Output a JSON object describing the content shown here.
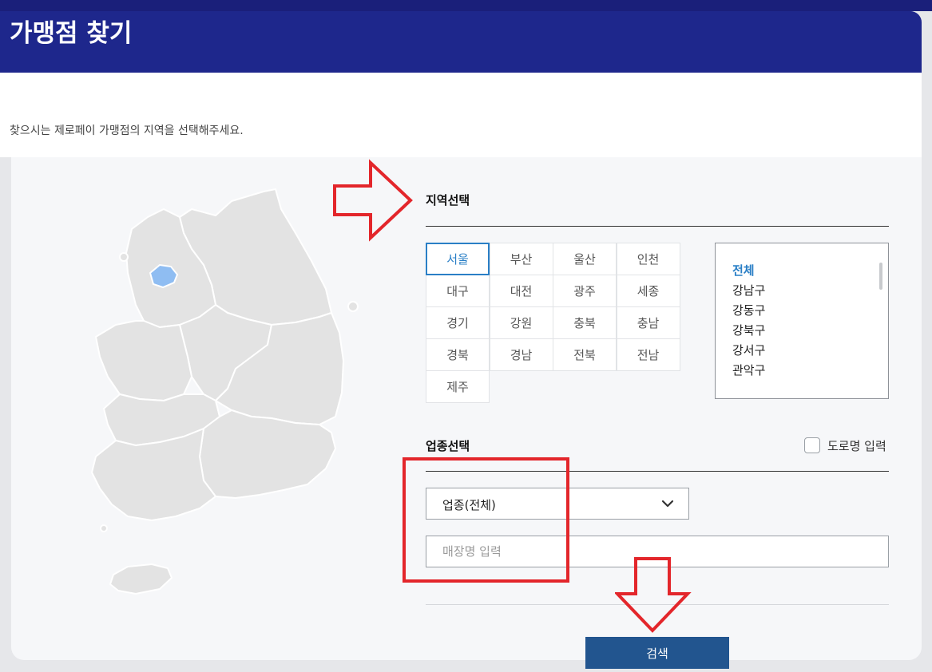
{
  "header": {
    "title": "가맹점 찾기"
  },
  "intro": {
    "text": "찾으시는 제로페이 가맹점의 지역을 선택해주세요."
  },
  "region_section": {
    "title": "지역선택",
    "regions": [
      {
        "label": "서울",
        "selected": true
      },
      {
        "label": "부산",
        "selected": false
      },
      {
        "label": "울산",
        "selected": false
      },
      {
        "label": "인천",
        "selected": false
      },
      {
        "label": "대구",
        "selected": false
      },
      {
        "label": "대전",
        "selected": false
      },
      {
        "label": "광주",
        "selected": false
      },
      {
        "label": "세종",
        "selected": false
      },
      {
        "label": "경기",
        "selected": false
      },
      {
        "label": "강원",
        "selected": false
      },
      {
        "label": "충북",
        "selected": false
      },
      {
        "label": "충남",
        "selected": false
      },
      {
        "label": "경북",
        "selected": false
      },
      {
        "label": "경남",
        "selected": false
      },
      {
        "label": "전북",
        "selected": false
      },
      {
        "label": "전남",
        "selected": false
      },
      {
        "label": "제주",
        "selected": false
      }
    ],
    "districts": [
      "전체",
      "강남구",
      "강동구",
      "강북구",
      "강서구",
      "관악구"
    ],
    "selected_district": "전체"
  },
  "business_section": {
    "title": "업종선택",
    "road_name_label": "도로명 입력",
    "road_name_checked": false,
    "category_value": "업종(전체)",
    "store_name_placeholder": "매장명 입력"
  },
  "search_button": {
    "label": "검색"
  },
  "colors": {
    "header": "#1e278c",
    "accent": "#2a7fc6",
    "button": "#22558f",
    "map_land": "#e3e3e3",
    "map_highlight": "#8fbdf2",
    "annotation": "#e3262b"
  }
}
